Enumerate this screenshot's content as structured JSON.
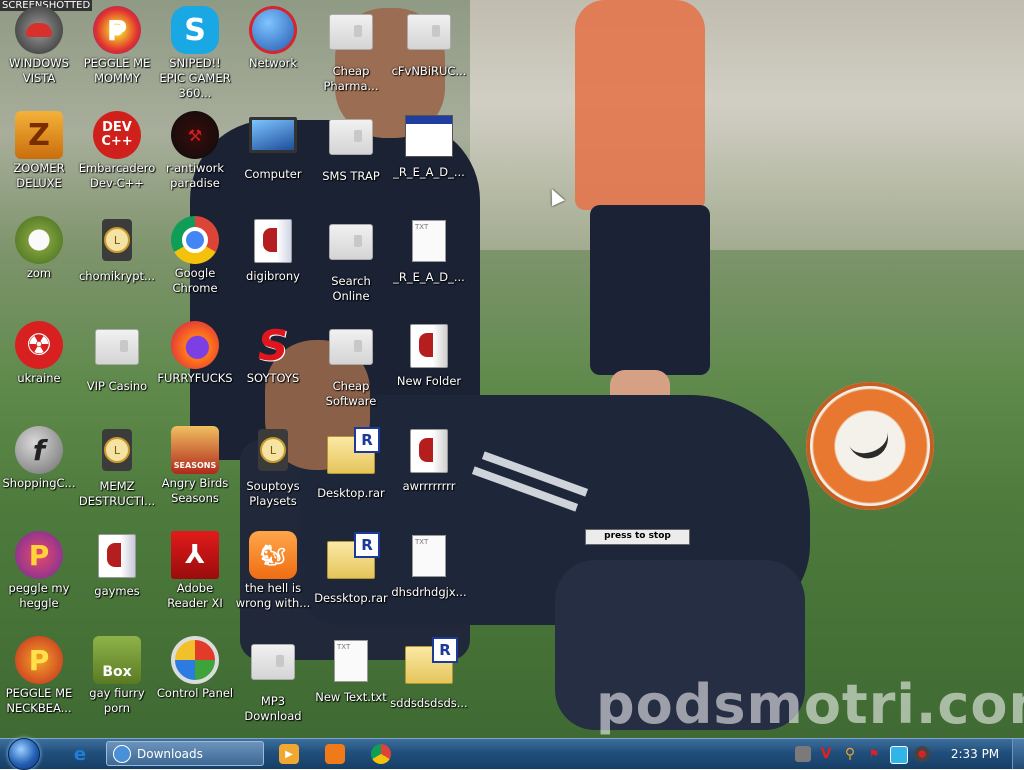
{
  "overlay_top_left": "SCREENSHOTTED",
  "watermark": "podsmotri.com",
  "press_to_stop": "press to stop",
  "icons": [
    {
      "label": "WINDOWS VISTA"
    },
    {
      "label": "PEGGLE ME MOMMY"
    },
    {
      "label": "SNIPED!! EPIC GAMER 360..."
    },
    {
      "label": "Network"
    },
    {
      "label": "Cheap Pharma..."
    },
    {
      "label": "cFvNBiRUC..."
    },
    {
      "label": "ZOOMER DELUXE"
    },
    {
      "label": "Embarcadero Dev-C++"
    },
    {
      "label": "r-antiwork paradise"
    },
    {
      "label": "Computer"
    },
    {
      "label": "SMS TRAP"
    },
    {
      "label": "_R_E_A_D_..."
    },
    {
      "label": "zom"
    },
    {
      "label": "chomikrypt..."
    },
    {
      "label": "Google Chrome"
    },
    {
      "label": "digibrony"
    },
    {
      "label": "Search Online"
    },
    {
      "label": "_R_E_A_D_..."
    },
    {
      "label": "ukraine"
    },
    {
      "label": "VIP Casino"
    },
    {
      "label": "FURRYFUCKS"
    },
    {
      "label": "SOYTOYS"
    },
    {
      "label": "Cheap Software"
    },
    {
      "label": "New Folder"
    },
    {
      "label": "ShoppingC..."
    },
    {
      "label": "MEMZ DESTRUCTI..."
    },
    {
      "label": "Angry Birds Seasons"
    },
    {
      "label": "Souptoys Playsets"
    },
    {
      "label": "Desktop.rar"
    },
    {
      "label": "awrrrrrrrr"
    },
    {
      "label": "peggle my heggle"
    },
    {
      "label": "gaymes"
    },
    {
      "label": "Adobe Reader XI"
    },
    {
      "label": "the hell is wrong with..."
    },
    {
      "label": "Dessktop.rar"
    },
    {
      "label": "dhsdrhdgjx..."
    },
    {
      "label": "PEGGLE ME NECKBEA..."
    },
    {
      "label": "gay fiurry porn"
    },
    {
      "label": "Control Panel"
    },
    {
      "label": "MP3 Download"
    },
    {
      "label": "New Text.txt"
    },
    {
      "label": "sddsdsdsds..."
    }
  ],
  "icon_glyphs": {
    "dev_line1": "DEV",
    "dev_line2": "C++",
    "box_text": "Box",
    "rar_badge": "R",
    "txt_tag": "TXT",
    "seasons_tag": "SEASONS",
    "soytoys_letter": "S",
    "peggle_letter": "P"
  },
  "taskbar": {
    "active_window": "Downloads",
    "clock": "2:33 PM"
  },
  "colors": {
    "taskbar": "#214f7c",
    "icon_label_text": "#ffffff",
    "rar_badge": "#1b3a9b"
  }
}
